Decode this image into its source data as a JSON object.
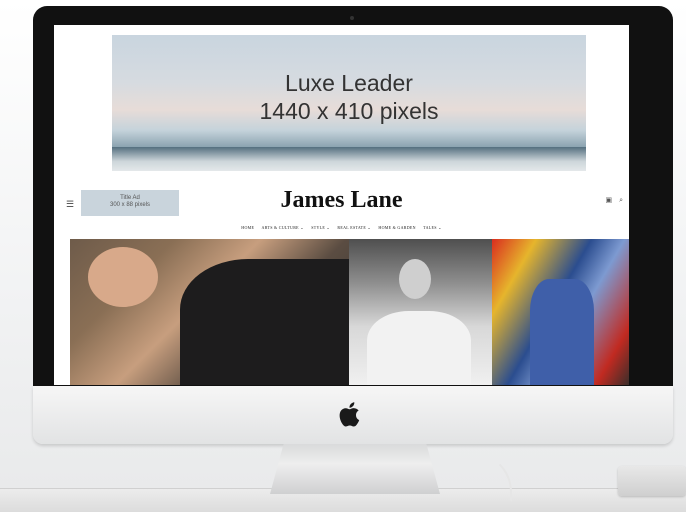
{
  "leader_ad": {
    "line1": "Luxe Leader",
    "line2": "1440 x 410 pixels"
  },
  "header": {
    "menu_icon": "☰",
    "title_ad_line1": "Title Ad",
    "title_ad_line2": "300 x 88 pixels",
    "brand": "James Lane",
    "icons": [
      "bag-icon",
      "search-icon"
    ]
  },
  "nav": {
    "items": [
      "HOME",
      "ARTS & CULTURE ⌄",
      "STYLE ⌄",
      "REAL ESTATE ⌄",
      "HOME & GARDEN",
      "TALES ⌄"
    ]
  },
  "colors": {
    "ad_box": "#c9d4dc",
    "brand_text": "#111111",
    "bezel": "#111111"
  }
}
